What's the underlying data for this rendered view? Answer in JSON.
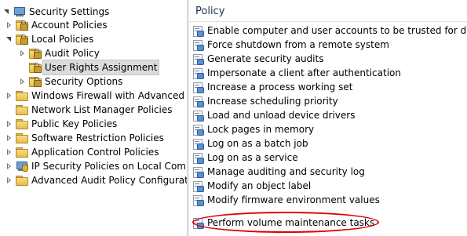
{
  "tree": {
    "root": "Security Settings",
    "items": [
      {
        "label": "Account Policies",
        "level": 1,
        "state": "closed",
        "icon": "locked-folder-icon"
      },
      {
        "label": "Local Policies",
        "level": 1,
        "state": "open",
        "icon": "locked-folder-icon"
      },
      {
        "label": "Audit Policy",
        "level": 2,
        "state": "closed",
        "icon": "locked-folder-icon"
      },
      {
        "label": "User Rights Assignment",
        "level": 2,
        "state": "none",
        "icon": "locked-folder-icon",
        "selected": true
      },
      {
        "label": "Security Options",
        "level": 2,
        "state": "closed",
        "icon": "locked-folder-icon"
      },
      {
        "label": "Windows Firewall with Advanced Secu",
        "level": 1,
        "state": "closed",
        "icon": "folder-icon"
      },
      {
        "label": "Network List Manager Policies",
        "level": 1,
        "state": "none",
        "icon": "folder-icon"
      },
      {
        "label": "Public Key Policies",
        "level": 1,
        "state": "closed",
        "icon": "folder-icon"
      },
      {
        "label": "Software Restriction Policies",
        "level": 1,
        "state": "closed",
        "icon": "folder-icon"
      },
      {
        "label": "Application Control Policies",
        "level": 1,
        "state": "closed",
        "icon": "folder-icon"
      },
      {
        "label": "IP Security Policies on Local Compute",
        "level": 1,
        "state": "closed",
        "icon": "computer-shield-icon"
      },
      {
        "label": "Advanced Audit Policy Configuration",
        "level": 1,
        "state": "closed",
        "icon": "folder-icon"
      }
    ]
  },
  "policy_list": {
    "header": "Policy",
    "items": [
      "Enable computer and user accounts to be trusted for delega",
      "Force shutdown from a remote system",
      "Generate security audits",
      "Impersonate a client after authentication",
      "Increase a process working set",
      "Increase scheduling priority",
      "Load and unload device drivers",
      "Lock pages in memory",
      "Log on as a batch job",
      "Log on as a service",
      "Manage auditing and security log",
      "Modify an object label",
      "Modify firmware environment values",
      "Perform volume maintenance tasks"
    ],
    "highlighted": "Perform volume maintenance tasks"
  },
  "colors": {
    "highlight_ellipse": "#e00000",
    "selection": "#dcdcdc",
    "header_text": "#1e3250"
  }
}
